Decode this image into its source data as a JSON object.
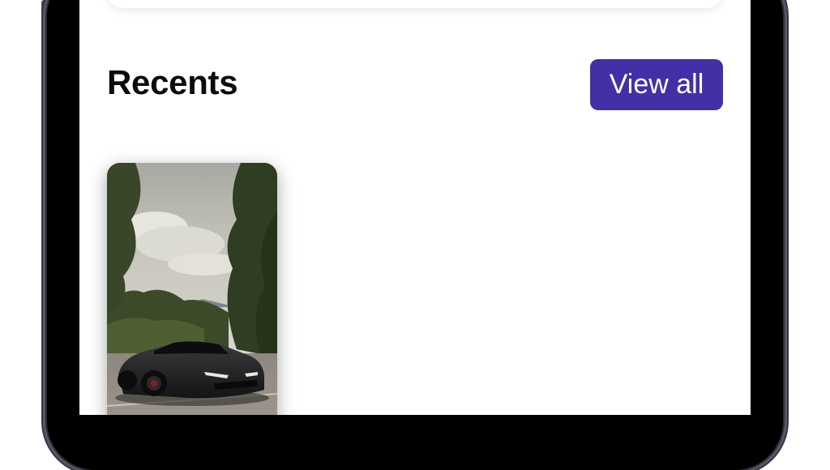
{
  "recents": {
    "title": "Recents",
    "view_all_label": "View all",
    "items": [
      {
        "image_subject": "black sports car in parking lot with trees"
      }
    ]
  },
  "colors": {
    "accent": "#4330a6",
    "title_text": "#0b0b0b",
    "screen_background": "#ffffff",
    "device_frame": "#000000"
  },
  "icons": {
    "card_image": "car-photo"
  }
}
